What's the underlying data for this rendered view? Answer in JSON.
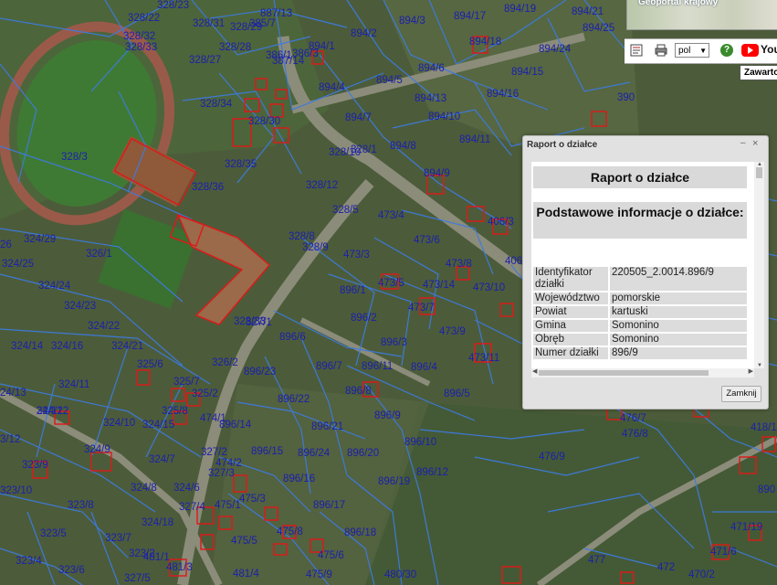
{
  "map": {
    "parcel_labels": [
      "328/23",
      "328/22",
      "328/32",
      "328/33",
      "328/31",
      "328/29",
      "328/27",
      "328/28",
      "385/7",
      "887/13",
      "386/1",
      "386/3",
      "387/14",
      "894/1",
      "894/3",
      "894/17",
      "894/19",
      "894/21",
      "894/25",
      "894/2",
      "894/18",
      "894/24",
      "894/6",
      "894/5",
      "894/15",
      "894/4",
      "894/13",
      "894/16",
      "390",
      "894/10",
      "894/7",
      "328/34",
      "328/30",
      "328/10",
      "328/1",
      "894/8",
      "894/11",
      "328/3",
      "328/35",
      "894/9",
      "328/36",
      "328/12",
      "473/4",
      "406/3",
      "328/5",
      "326/1",
      "324/29",
      "26",
      "324/25",
      "328/8",
      "328/9",
      "473/6",
      "473/3",
      "406",
      "324/24",
      "473/8",
      "896/1",
      "473/5",
      "473/14",
      "473/10",
      "324/23",
      "896/2",
      "473/7",
      "324/22",
      "328/33",
      "327/1",
      "896/6",
      "473/9",
      "896/3",
      "324/21",
      "324/14",
      "324/16",
      "473/11",
      "325/6",
      "326/2",
      "896/7",
      "896/11",
      "896/4",
      "324/11",
      "325/7",
      "896/23",
      "896/8",
      "896/5",
      "325/2",
      "896/22",
      "324/12",
      "325/8",
      "474/1",
      "896/14",
      "896/9",
      "476/7",
      "324/10",
      "324/15",
      "896/21",
      "476/8",
      "418/1",
      "896/10",
      "324/9",
      "327/2",
      "474/2",
      "896/15",
      "896/24",
      "896/20",
      "476/9",
      "323/9",
      "327/3",
      "324/7",
      "896/12",
      "324/6",
      "896/16",
      "896/19",
      "324/8",
      "475/3",
      "890",
      "475/1",
      "323/8",
      "327/4",
      "896/17",
      "475/8",
      "471/19",
      "324/18",
      "896/18",
      "323/5",
      "323/7",
      "475/5",
      "471/6",
      "323/2",
      "481/1",
      "475/6",
      "477",
      "323/4",
      "323/6",
      "481/3",
      "481/4",
      "475/9",
      "480/30",
      "472",
      "470/2",
      "327/5",
      "24/13",
      "24/12",
      "323/10",
      "3/12"
    ]
  },
  "toolbar": {
    "mini_map_title": "Geoportal krajowy",
    "print_icon": "printer-icon",
    "report_icon": "report-icon",
    "language_select": "pol",
    "help_label": "?",
    "youtube_label": "YouTu",
    "tooltip": "Zawarto"
  },
  "dialog": {
    "window_title": "Raport o działce",
    "minimize_label": "–",
    "close_label": "×",
    "heading": "Raport o działce",
    "subheading": "Podstawowe informacje o działce:",
    "rows": [
      {
        "key": "Identyfikator działki",
        "value": "220505_2.0014.896/9"
      },
      {
        "key": "Województwo",
        "value": "pomorskie"
      },
      {
        "key": "Powiat",
        "value": "kartuski"
      },
      {
        "key": "Gmina",
        "value": "Somonino"
      },
      {
        "key": "Obręb",
        "value": "Somonino"
      },
      {
        "key": "Numer działki",
        "value": "896/9"
      }
    ],
    "close_button": "Zamknij"
  },
  "colors": {
    "parcel_line": "#3d7be0",
    "parcel_label": "#1b1fae",
    "building_outline": "#e01818",
    "dialog_bg": "#e1e1e1"
  }
}
